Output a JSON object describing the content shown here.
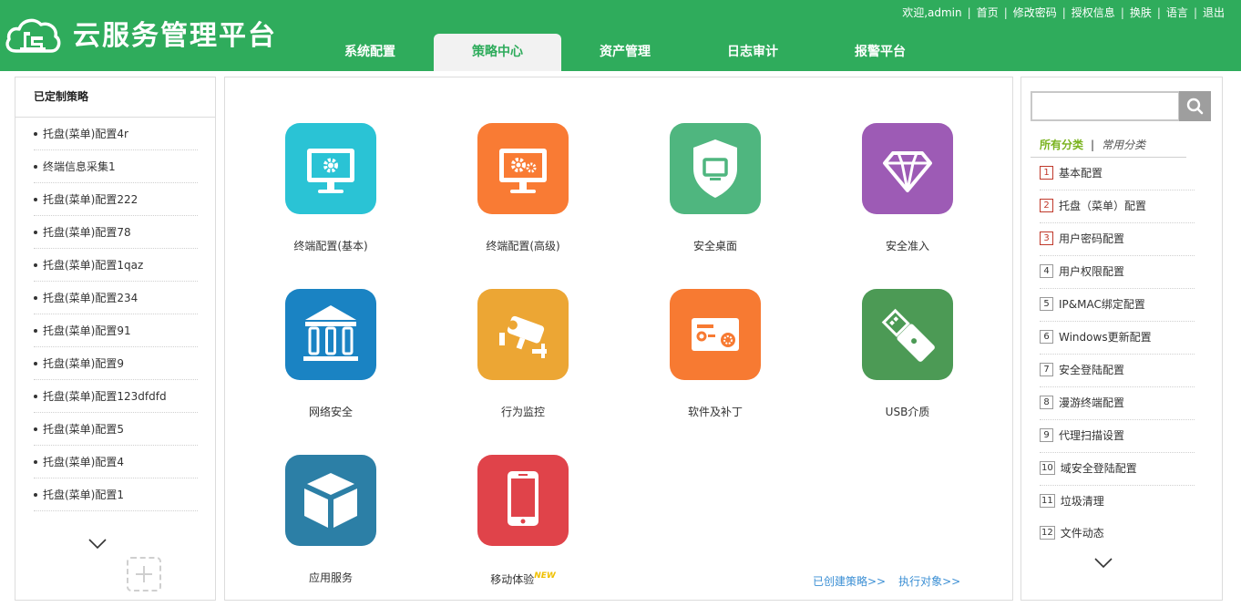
{
  "header": {
    "title": "云服务管理平台",
    "welcome": "欢迎,admin",
    "links": [
      "首页",
      "修改密码",
      "授权信息",
      "换肤",
      "语言",
      "退出"
    ],
    "tabs": [
      {
        "label": "系统配置",
        "active": false
      },
      {
        "label": "策略中心",
        "active": true
      },
      {
        "label": "资产管理",
        "active": false
      },
      {
        "label": "日志审计",
        "active": false
      },
      {
        "label": "报警平台",
        "active": false
      }
    ],
    "colors": {
      "brand": "#2fac5c",
      "active_tab_bg": "#f2f2f2"
    }
  },
  "left_panel": {
    "title": "已定制策略",
    "items": [
      "托盘(菜单)配置4r",
      "终端信息采集1",
      "托盘(菜单)配置222",
      "托盘(菜单)配置78",
      "托盘(菜单)配置1qaz",
      "托盘(菜单)配置234",
      "托盘(菜单)配置91",
      "托盘(菜单)配置9",
      "托盘(菜单)配置123dfdfd",
      "托盘(菜单)配置5",
      "托盘(菜单)配置4",
      "托盘(菜单)配置1"
    ]
  },
  "center_panel": {
    "tiles": [
      {
        "label": "终端配置(基本)",
        "icon": "monitor-gear-icon",
        "color": "#2ac3d5"
      },
      {
        "label": "终端配置(高级)",
        "icon": "monitor-gears-icon",
        "color": "#f97b34"
      },
      {
        "label": "安全桌面",
        "icon": "shield-monitor-icon",
        "color": "#4fb67f"
      },
      {
        "label": "安全准入",
        "icon": "diamond-icon",
        "color": "#9d5bb5"
      },
      {
        "label": "网络安全",
        "icon": "bank-icon",
        "color": "#1a83c3"
      },
      {
        "label": "行为监控",
        "icon": "camera-icon",
        "color": "#eca634"
      },
      {
        "label": "软件及补丁",
        "icon": "software-card-icon",
        "color": "#f77a32"
      },
      {
        "label": "USB介质",
        "icon": "usb-icon",
        "color": "#4c9a55"
      },
      {
        "label": "应用服务",
        "icon": "cube-icon",
        "color": "#2c7fa6"
      },
      {
        "label": "移动体验",
        "icon": "phone-icon",
        "color": "#e0434a",
        "badge": "NEW"
      }
    ],
    "links": [
      "已创建策略>>",
      "执行对象>>"
    ]
  },
  "right_panel": {
    "search": {
      "placeholder": "",
      "value": ""
    },
    "tabs": {
      "all": "所有分类",
      "separator": "|",
      "common": "常用分类"
    },
    "categories": [
      {
        "num": "1",
        "label": "基本配置",
        "highlight": true
      },
      {
        "num": "2",
        "label": "托盘（菜单）配置",
        "highlight": true
      },
      {
        "num": "3",
        "label": "用户密码配置",
        "highlight": true
      },
      {
        "num": "4",
        "label": "用户权限配置",
        "highlight": false
      },
      {
        "num": "5",
        "label": "IP&MAC绑定配置",
        "highlight": false
      },
      {
        "num": "6",
        "label": "Windows更新配置",
        "highlight": false
      },
      {
        "num": "7",
        "label": "安全登陆配置",
        "highlight": false
      },
      {
        "num": "8",
        "label": "漫游终端配置",
        "highlight": false
      },
      {
        "num": "9",
        "label": "代理扫描设置",
        "highlight": false
      },
      {
        "num": "10",
        "label": "域安全登陆配置",
        "highlight": false
      },
      {
        "num": "11",
        "label": "垃圾清理",
        "highlight": false
      },
      {
        "num": "12",
        "label": "文件动态",
        "highlight": false
      }
    ]
  }
}
